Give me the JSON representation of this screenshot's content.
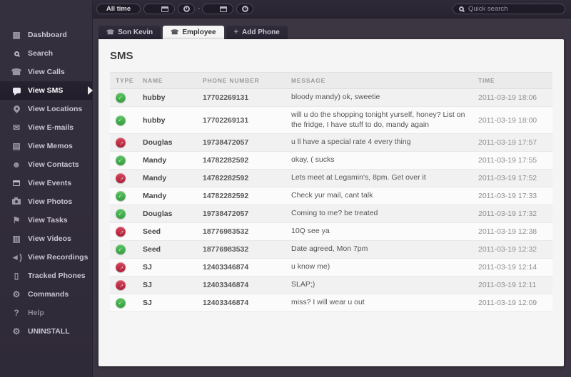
{
  "colors": {
    "incoming_green": "#44ae4d",
    "outgoing_red": "#c22b45",
    "sidebar_bg": "#322d3b",
    "panel_bg": "#f5f5f5"
  },
  "topbar": {
    "time_filter": "All time",
    "range_separator": "-",
    "search_placeholder": "Quick search"
  },
  "sidebar": {
    "items": [
      {
        "label": "Dashboard",
        "icon": "dashboard-grid-icon",
        "active": false
      },
      {
        "label": "Search",
        "icon": "search-icon",
        "active": false
      },
      {
        "label": "View Calls",
        "icon": "phone-icon",
        "active": false
      },
      {
        "label": "View SMS",
        "icon": "sms-bubble-icon",
        "active": true
      },
      {
        "label": "View Locations",
        "icon": "location-pin-icon",
        "active": false
      },
      {
        "label": "View E-mails",
        "icon": "envelope-icon",
        "active": false
      },
      {
        "label": "View Memos",
        "icon": "memo-icon",
        "active": false
      },
      {
        "label": "View Contacts",
        "icon": "contacts-icon",
        "active": false
      },
      {
        "label": "View Events",
        "icon": "calendar-icon",
        "active": false
      },
      {
        "label": "View Photos",
        "icon": "camera-icon",
        "active": false
      },
      {
        "label": "View Tasks",
        "icon": "flag-icon",
        "active": false
      },
      {
        "label": "View Videos",
        "icon": "film-icon",
        "active": false
      },
      {
        "label": "View Recordings",
        "icon": "speaker-icon",
        "active": false
      },
      {
        "label": "Tracked Phones",
        "icon": "mobile-phone-icon",
        "active": false
      },
      {
        "label": "Commands",
        "icon": "gear-icon",
        "active": false
      },
      {
        "label": "Help",
        "icon": "help-icon",
        "active": false,
        "muted": true
      },
      {
        "label": "UNINSTALL",
        "icon": "uninstall-gear-icon",
        "active": false
      }
    ]
  },
  "tabs": [
    {
      "label": "Son Kevin",
      "icon": "phone-icon",
      "active": false
    },
    {
      "label": "Employee",
      "icon": "phone-icon",
      "active": true
    },
    {
      "label": "Add Phone",
      "icon": "plus-icon",
      "active": false
    }
  ],
  "main": {
    "title": "SMS",
    "table": {
      "columns": [
        "TYPE",
        "NAME",
        "PHONE NUMBER",
        "MESSAGE",
        "TIME"
      ],
      "rows": [
        {
          "type": "incoming",
          "name": "hubby",
          "phone": "17702269131",
          "message": "bloody mandy) ok, sweetie",
          "time": "2011-03-19 18:06"
        },
        {
          "type": "incoming",
          "name": "hubby",
          "phone": "17702269131",
          "message": "will u do the shopping tonight yurself, honey? List on the fridge, I have stuff to do, mandy again",
          "time": "2011-03-19 18:00"
        },
        {
          "type": "outgoing",
          "name": "Douglas",
          "phone": "19738472057",
          "message": "u ll have a special rate 4 every thing",
          "time": "2011-03-19 17:57"
        },
        {
          "type": "incoming",
          "name": "Mandy",
          "phone": "14782282592",
          "message": "okay, ( sucks",
          "time": "2011-03-19 17:55"
        },
        {
          "type": "outgoing",
          "name": "Mandy",
          "phone": "14782282592",
          "message": "Lets meet at Legamin's, 8pm. Get over it",
          "time": "2011-03-19 17:52"
        },
        {
          "type": "incoming",
          "name": "Mandy",
          "phone": "14782282592",
          "message": "Check yur mail, cant talk",
          "time": "2011-03-19 17:33"
        },
        {
          "type": "incoming",
          "name": "Douglas",
          "phone": "19738472057",
          "message": "Coming to me? be treated",
          "time": "2011-03-19 17:32"
        },
        {
          "type": "outgoing",
          "name": "Seed",
          "phone": "18776983532",
          "message": "10Q see ya",
          "time": "2011-03-19 12:38"
        },
        {
          "type": "incoming",
          "name": "Seed",
          "phone": "18776983532",
          "message": "Date agreed, Mon 7pm",
          "time": "2011-03-19 12:32"
        },
        {
          "type": "outgoing",
          "name": "SJ",
          "phone": "12403346874",
          "message": "u know me)",
          "time": "2011-03-19 12:14"
        },
        {
          "type": "outgoing",
          "name": "SJ",
          "phone": "12403346874",
          "message": "SLAP;)",
          "time": "2011-03-19 12:11"
        },
        {
          "type": "incoming",
          "name": "SJ",
          "phone": "12403346874",
          "message": "miss? I will wear u out",
          "time": "2011-03-19 12:09"
        }
      ]
    }
  }
}
